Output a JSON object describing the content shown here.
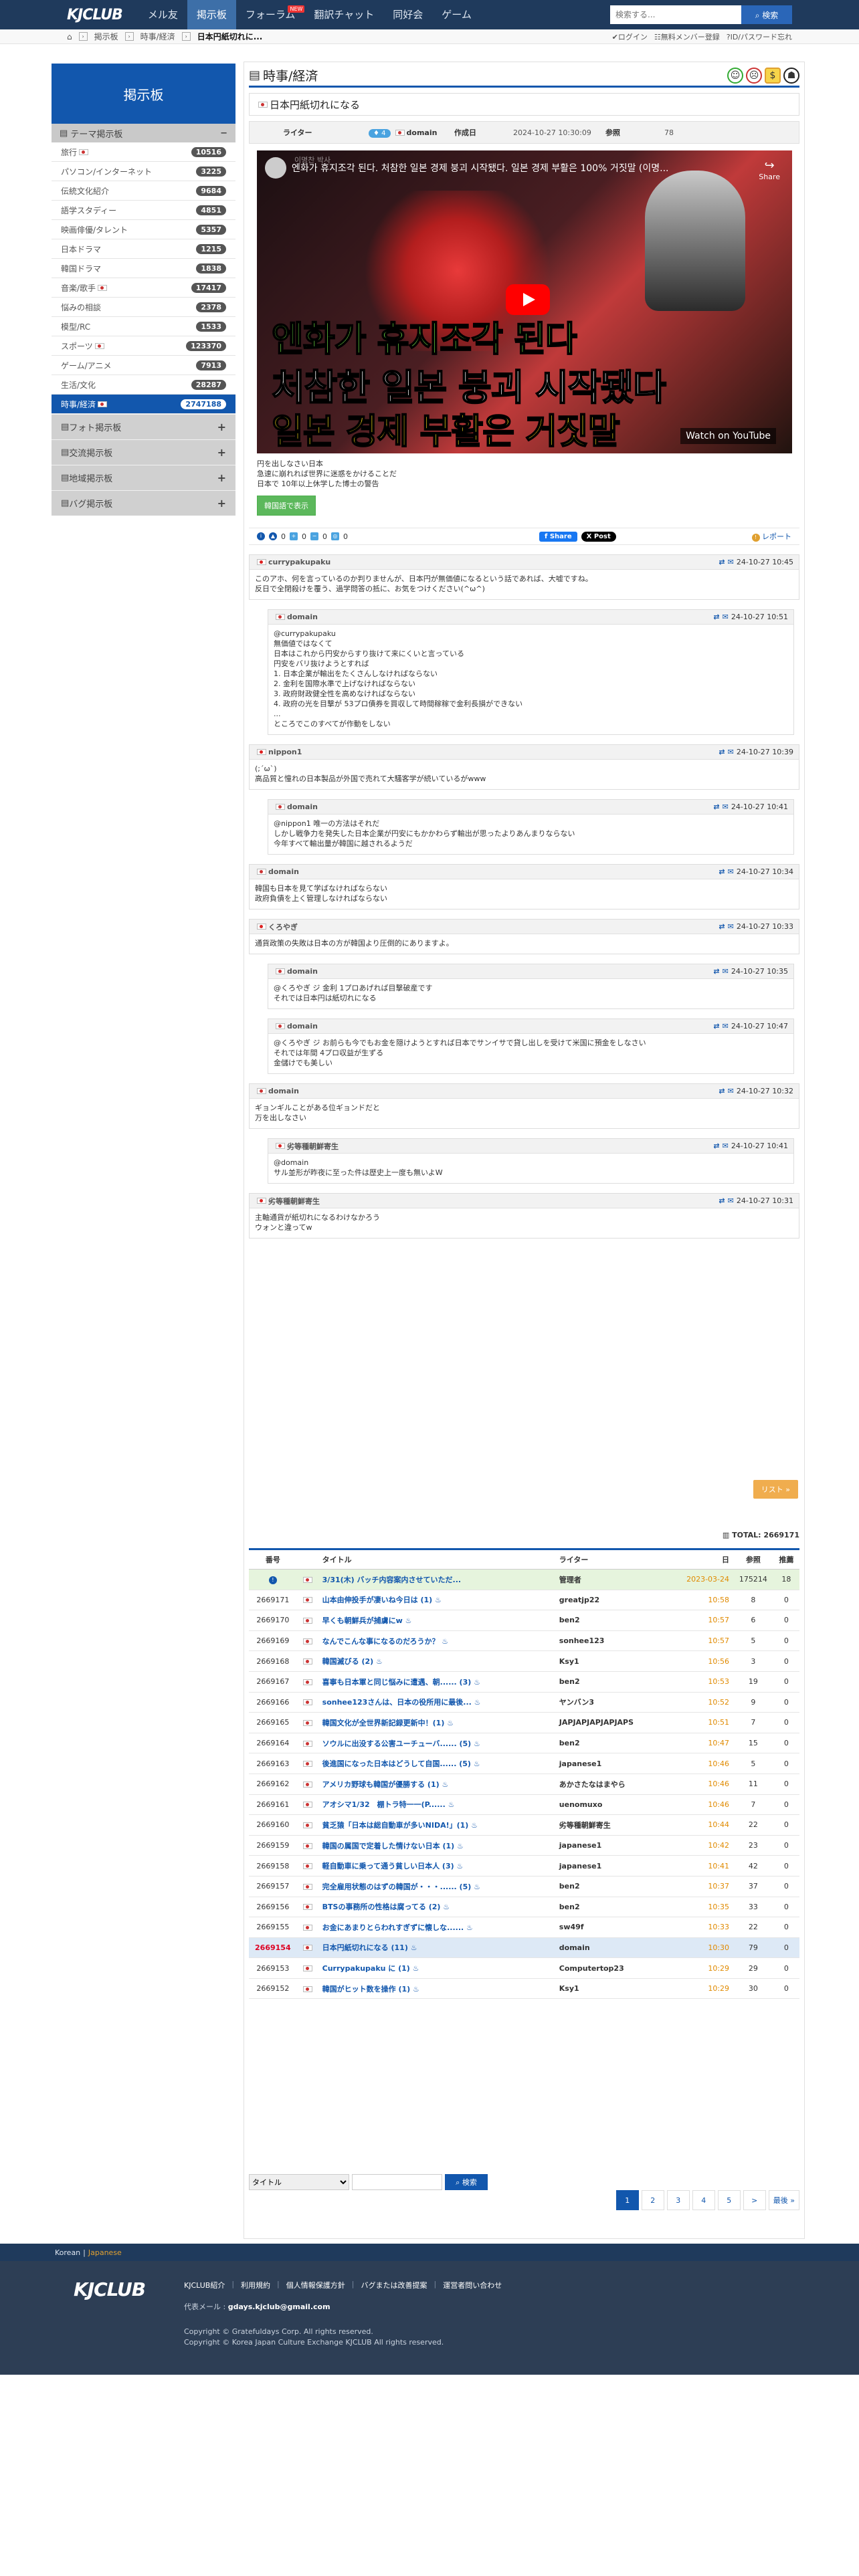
{
  "nav": {
    "logo": "KJCLUB",
    "items": [
      {
        "label": "メル友",
        "active": false
      },
      {
        "label": "掲示板",
        "active": true
      },
      {
        "label": "フォーラム",
        "active": false,
        "badge": "NEW"
      },
      {
        "label": "翻訳チャット",
        "active": false
      },
      {
        "label": "同好会",
        "active": false
      },
      {
        "label": "ゲーム",
        "active": false
      }
    ],
    "search_placeholder": "検索する...",
    "search_button": "検索"
  },
  "crumbs": {
    "board": "掲示板",
    "category": "時事/経済",
    "current": "日本円紙切れに...",
    "login": "ログイン",
    "register": "無料メンバー登録",
    "forgot": "ID/パスワード忘れ"
  },
  "sidebar": {
    "title": "掲示板",
    "section": "テーマ掲示板",
    "items": [
      {
        "label": "旅行",
        "count": "10516",
        "flag": true
      },
      {
        "label": "パソコン/インターネット",
        "count": "3225"
      },
      {
        "label": "伝統文化紹介",
        "count": "9684"
      },
      {
        "label": "語学スタディー",
        "count": "4851"
      },
      {
        "label": "映画俳優/タレント",
        "count": "5357"
      },
      {
        "label": "日本ドラマ",
        "count": "1215"
      },
      {
        "label": "韓国ドラマ",
        "count": "1838"
      },
      {
        "label": "音楽/歌手",
        "count": "17417",
        "flag": true
      },
      {
        "label": "悩みの相談",
        "count": "2378"
      },
      {
        "label": "模型/RC",
        "count": "1533"
      },
      {
        "label": "スポーツ",
        "count": "123370",
        "flag": true
      },
      {
        "label": "ゲーム/アニメ",
        "count": "7913"
      },
      {
        "label": "生活/文化",
        "count": "28287"
      },
      {
        "label": "時事/経済",
        "count": "2747188",
        "flag": true,
        "active": true
      }
    ],
    "groups": [
      "フォト掲示板",
      "交流掲示板",
      "地域掲示板",
      "バグ掲示板"
    ]
  },
  "main": {
    "heading": "時事/経済",
    "post": {
      "title": "日本円紙切れになる",
      "writer_label": "ライター",
      "level": "4",
      "writer": "domain",
      "date_label": "作成日",
      "date": "2024-10-27 10:30:09",
      "views_label": "参照",
      "views": "78",
      "video_title": "엔화가 휴지조각 된다. 처참한 일본 경제 붕괴 시작됐다. 일본 경제 부활은 100% 거짓말 (이명...",
      "video_channel": "이명찬 박사",
      "video_share": "Share",
      "video_line1": "엔화가 휴지조각 된다",
      "video_line2": "처참한 일본 붕괴 시작됐다",
      "video_line3": "일본 경제 부활은 거짓말",
      "video_watch": "Watch on YouTube",
      "body": [
        "円を出しなさい日本",
        "急速に崩れれば世界に迷惑をかけることだ",
        "日本で 10年以上休学した博士の警告"
      ],
      "translate_button": "韓国語で表示",
      "fb_label": "Share",
      "x_label": "X Post",
      "report_label": "レポート",
      "counts": [
        "0",
        "0",
        "0",
        "0"
      ]
    },
    "comments": [
      {
        "author": "currypakupaku",
        "flag": "jp",
        "time": "24-10-27 10:45",
        "indent": false,
        "lines": [
          "このアホ、何を言っているのか判りませんが、日本円が無価値になるという話であれば、大嘘ですね。",
          "反日で全閉殺けを覆う、過学問答の抵に、お気をつけください(^ω^)"
        ]
      },
      {
        "author": "domain",
        "flag": "kr",
        "time": "24-10-27 10:51",
        "indent": true,
        "lines": [
          "@currypakupaku",
          "無価値ではなくて",
          "日本はこれから円安からすり抜けて来にくいと言っている",
          "円安をバリ抜けようとすれば",
          "1. 日本企業が輸出をたくさんしなければならない",
          "2. 金利を国際水準で上げなければならない",
          "3. 政府財政健全性を高めなければならない",
          "4. 政府の光を目撃が 53プロ債券を買収して時間稼稼で金利長損ができない",
          "...",
          "ところでこのすべてが作動をしない"
        ]
      },
      {
        "author": "nippon1",
        "flag": "jp",
        "time": "24-10-27 10:39",
        "indent": false,
        "lines": [
          "(;´ω`)",
          "高品質と憧れの日本製品が外国で売れて大騒客学が続いているがwww"
        ]
      },
      {
        "author": "domain",
        "flag": "kr",
        "time": "24-10-27 10:41",
        "indent": true,
        "lines": [
          "@nippon1 唯一の方法はそれだ",
          "しかし戦争力を発失した日本企業が円安にもかかわらず輸出が思ったよりあんまりならない",
          "今年すべて輸出量が韓国に越されるようだ"
        ]
      },
      {
        "author": "domain",
        "flag": "kr",
        "time": "24-10-27 10:34",
        "indent": false,
        "lines": [
          "韓国も日本を見て学ばなければならない",
          "政府負債を上く管理しなければならない"
        ]
      },
      {
        "author": "くろやぎ",
        "flag": "jp",
        "time": "24-10-27 10:33",
        "indent": false,
        "lines": [
          "通貨政策の失敗は日本の方が韓国より圧倒的にありますよ。"
        ]
      },
      {
        "author": "domain",
        "flag": "kr",
        "time": "24-10-27 10:35",
        "indent": true,
        "lines": [
          "@くろやぎ ジ 金利 1プロあげれば目撃破産です",
          "それでは日本円は紙切れになる"
        ]
      },
      {
        "author": "domain",
        "flag": "kr",
        "time": "24-10-27 10:47",
        "indent": true,
        "lines": [
          "@くろやぎ ジ お前らも今でもお金を隠けようとすれば日本でサンイサで貸し出しを受けて米国に預金をしなさい",
          "それでは年間 4プロ収益が生ずる",
          "金儲けでも美しい"
        ]
      },
      {
        "author": "domain",
        "flag": "kr",
        "time": "24-10-27 10:32",
        "indent": false,
        "lines": [
          "ギョンギルことがある位ギョンドだと",
          "万を出しなさい"
        ]
      },
      {
        "author": "劣等種朝鮮寄生",
        "flag": "jp",
        "time": "24-10-27 10:41",
        "indent": true,
        "lines": [
          "@domain",
          "サル並形が昨夜に至った件は歴史上一度も無いよW"
        ]
      },
      {
        "author": "劣等種朝鮮寄生",
        "flag": "jp",
        "time": "24-10-27 10:31",
        "indent": false,
        "lines": [
          "主軸通貨が紙切れになるわけなかろう",
          "ウォンと違ってw"
        ]
      }
    ],
    "list_button": "リスト",
    "total_label": "TOTAL: 2669171",
    "table": {
      "headers": [
        "番号",
        "タイトル",
        "ライター",
        "日",
        "参照",
        "推薦"
      ],
      "rows": [
        {
          "num": "",
          "title": "3/31(木) バッチ内容案内させていただ...",
          "author": "管理者",
          "date": "2023-03-24",
          "views": "175214",
          "rec": "18",
          "notice": true
        },
        {
          "num": "2669171",
          "title": "山本由伸投手が凄いね今日は (1)",
          "author": "greatjp22",
          "date": "10:58",
          "views": "8",
          "rec": "0"
        },
        {
          "num": "2669170",
          "title": "早くも朝鮮兵が捕虜にw",
          "author": "ben2",
          "date": "10:57",
          "views": "6",
          "rec": "0"
        },
        {
          "num": "2669169",
          "title": "なんでこんな事になるのだろうか？",
          "author": "sonhee123",
          "date": "10:57",
          "views": "5",
          "rec": "0"
        },
        {
          "num": "2669168",
          "title": "韓国滅びる (2)",
          "author": "Ksy1",
          "date": "10:56",
          "views": "3",
          "rec": "0"
        },
        {
          "num": "2669167",
          "title": "喜寧も日本軍と同じ悩みに遭遇、朝...... (3)",
          "author": "ben2",
          "date": "10:53",
          "views": "19",
          "rec": "0"
        },
        {
          "num": "2669166",
          "title": "sonhee123さんは、日本の役所用に最後...",
          "author": "ヤンバン3",
          "date": "10:52",
          "views": "9",
          "rec": "0"
        },
        {
          "num": "2669165",
          "title": "韓国文化が全世界新記録更新中！(1)",
          "author": "JAPJAPJAPJAPJAPS",
          "date": "10:51",
          "views": "7",
          "rec": "0"
        },
        {
          "num": "2669164",
          "title": "ソウルに出没する公害ユーチューバ...... (5)",
          "author": "ben2",
          "date": "10:47",
          "views": "15",
          "rec": "0"
        },
        {
          "num": "2669163",
          "title": "後進国になった日本はどうして自国...... (5)",
          "author": "japanese1",
          "date": "10:46",
          "views": "5",
          "rec": "0"
        },
        {
          "num": "2669162",
          "title": "アメリカ野球も韓国が優勝する (1)",
          "author": "あかさたなはまやら",
          "date": "10:46",
          "views": "11",
          "rec": "0"
        },
        {
          "num": "2669161",
          "title": "アオシマ1/32　棚トラ特一一(P...... ",
          "author": "uenomuxo",
          "date": "10:46",
          "views": "7",
          "rec": "0"
        },
        {
          "num": "2669160",
          "title": "貧乏猿「日本は総自動車が多いNIDA!」(1)",
          "author": "劣等種朝鮮寄生",
          "date": "10:44",
          "views": "22",
          "rec": "0"
        },
        {
          "num": "2669159",
          "title": "韓国の属国で定着した情けない日本 (1)",
          "author": "japanese1",
          "date": "10:42",
          "views": "23",
          "rec": "0"
        },
        {
          "num": "2669158",
          "title": "軽自動車に乗って通う貧しい日本人 (3)",
          "author": "japanese1",
          "date": "10:41",
          "views": "42",
          "rec": "0"
        },
        {
          "num": "2669157",
          "title": "完全雇用状態のはずの韓国が・・・...... (5)",
          "author": "ben2",
          "date": "10:37",
          "views": "37",
          "rec": "0"
        },
        {
          "num": "2669156",
          "title": "BTSの事務所の性格は腐ってる (2)",
          "author": "ben2",
          "date": "10:35",
          "views": "33",
          "rec": "0"
        },
        {
          "num": "2669155",
          "title": "お金にあまりとらわれすぎずに懐しな......",
          "author": "sw49f",
          "date": "10:33",
          "views": "22",
          "rec": "0"
        },
        {
          "num": "2669154",
          "title": "日本円紙切れになる (11)",
          "author": "domain",
          "date": "10:30",
          "views": "79",
          "rec": "0",
          "highlight": true
        },
        {
          "num": "2669153",
          "title": "Currypakupaku に (1)",
          "author": "Computertop23",
          "date": "10:29",
          "views": "29",
          "rec": "0"
        },
        {
          "num": "2669152",
          "title": "韓国がヒット数を操作 (1)",
          "author": "Ksy1",
          "date": "10:29",
          "views": "30",
          "rec": "0"
        }
      ]
    },
    "search": {
      "select": "タイトル",
      "button": "検索"
    },
    "pager": [
      "1",
      "2",
      "3",
      "4",
      "5",
      ">",
      "最後 »"
    ]
  },
  "footer": {
    "lang_korean": "Korean",
    "lang_japanese": "Japanese",
    "logo": "KJCLUB",
    "links": [
      "KJCLUB紹介",
      "利用規約",
      "個人情報保護方針",
      "バグまたは改善提案",
      "運営者問い合わせ"
    ],
    "mail_label": "代表メール :",
    "mail": "gdays.kjclub@gmail.com",
    "copy1": "Copyright © Gratefuldays Corp. All rights reserved.",
    "copy2": "Copyright © Korea Japan Culture Exchange KJCLUB All rights reserved."
  }
}
